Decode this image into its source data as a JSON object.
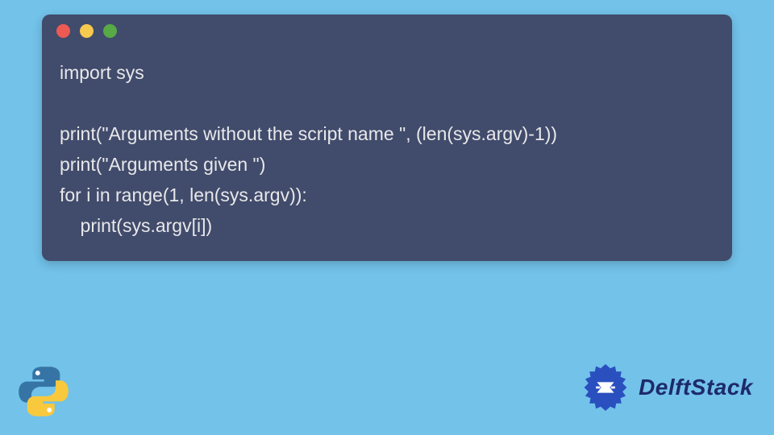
{
  "code": {
    "line1": "import sys",
    "line2": "",
    "line3": "print(\"Arguments without the script name \", (len(sys.argv)-1))",
    "line4": "print(\"Arguments given \")",
    "line5": "for i in range(1, len(sys.argv)):",
    "line6": "    print(sys.argv[i])"
  },
  "brand": {
    "name": "DelftStack"
  },
  "window": {
    "dot_colors": {
      "red": "#ec5a53",
      "yellow": "#f6c94f",
      "green": "#58aa46"
    }
  }
}
